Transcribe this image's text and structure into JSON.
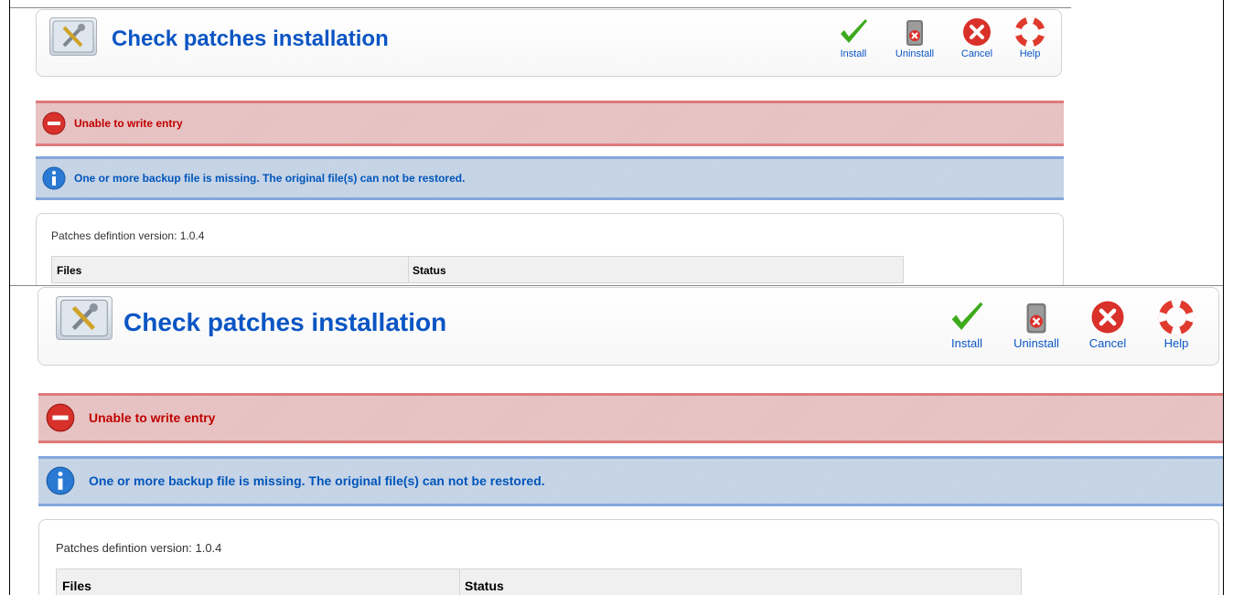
{
  "header": {
    "title": "Check patches installation"
  },
  "toolbar": {
    "install_label": "Install",
    "uninstall_label": "Uninstall",
    "cancel_label": "Cancel",
    "help_label": "Help"
  },
  "messages": {
    "error": "Unable to write entry",
    "notice": "One or more backup file is missing. The original file(s) can not be restored."
  },
  "content": {
    "version_text": "Patches defintion version: 1.0.4",
    "columns": [
      "Files",
      "Status"
    ]
  },
  "colors": {
    "title_blue": "#0b55c4",
    "error_text": "#c00000",
    "error_bg": "#e6c0c0",
    "notice_bg": "#c3d2e5",
    "install_green": "#3daa1c",
    "cancel_red": "#d9302a"
  },
  "icons": {
    "title": "tools-icon",
    "install": "checkmark-icon",
    "uninstall": "trash-icon",
    "cancel": "cancel-x-icon",
    "help": "lifebuoy-icon",
    "error": "no-entry-icon",
    "notice": "info-icon"
  }
}
